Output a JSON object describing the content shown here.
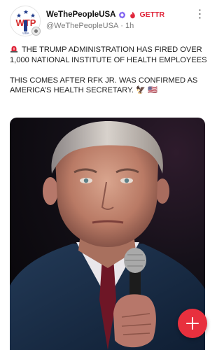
{
  "post": {
    "author": {
      "display_name": "WeThePeopleUSA",
      "handle": "@WeThePeopleUSA",
      "time_ago": "1h",
      "platform_label": "GETTR",
      "avatar_letters": "WTP",
      "avatar_small_text": "USA"
    },
    "text": {
      "line1": "THE TRUMP ADMINISTRATION HAS FIRED OVER 1,000 NATIONAL INSTITUTE OF HEALTH EMPLOYEES",
      "line2": "THIS COMES AFTER RFK JR. WAS CONFIRMED AS AMERICA’S HEALTH SECRETARY. 🦅 🇺🇸"
    },
    "media": {
      "description_icon": "portrait-photo"
    }
  },
  "icons": {
    "more": "more-options-icon",
    "siren": "siren-icon",
    "verified": "verified-badge-icon",
    "gettr": "gettr-flame-icon",
    "compose": "plus-icon"
  },
  "colors": {
    "accent_red": "#e8303e",
    "gettr_red": "#e0263b",
    "verified_purple": "#7b5cf0",
    "muted_text": "#7a7a7a"
  }
}
